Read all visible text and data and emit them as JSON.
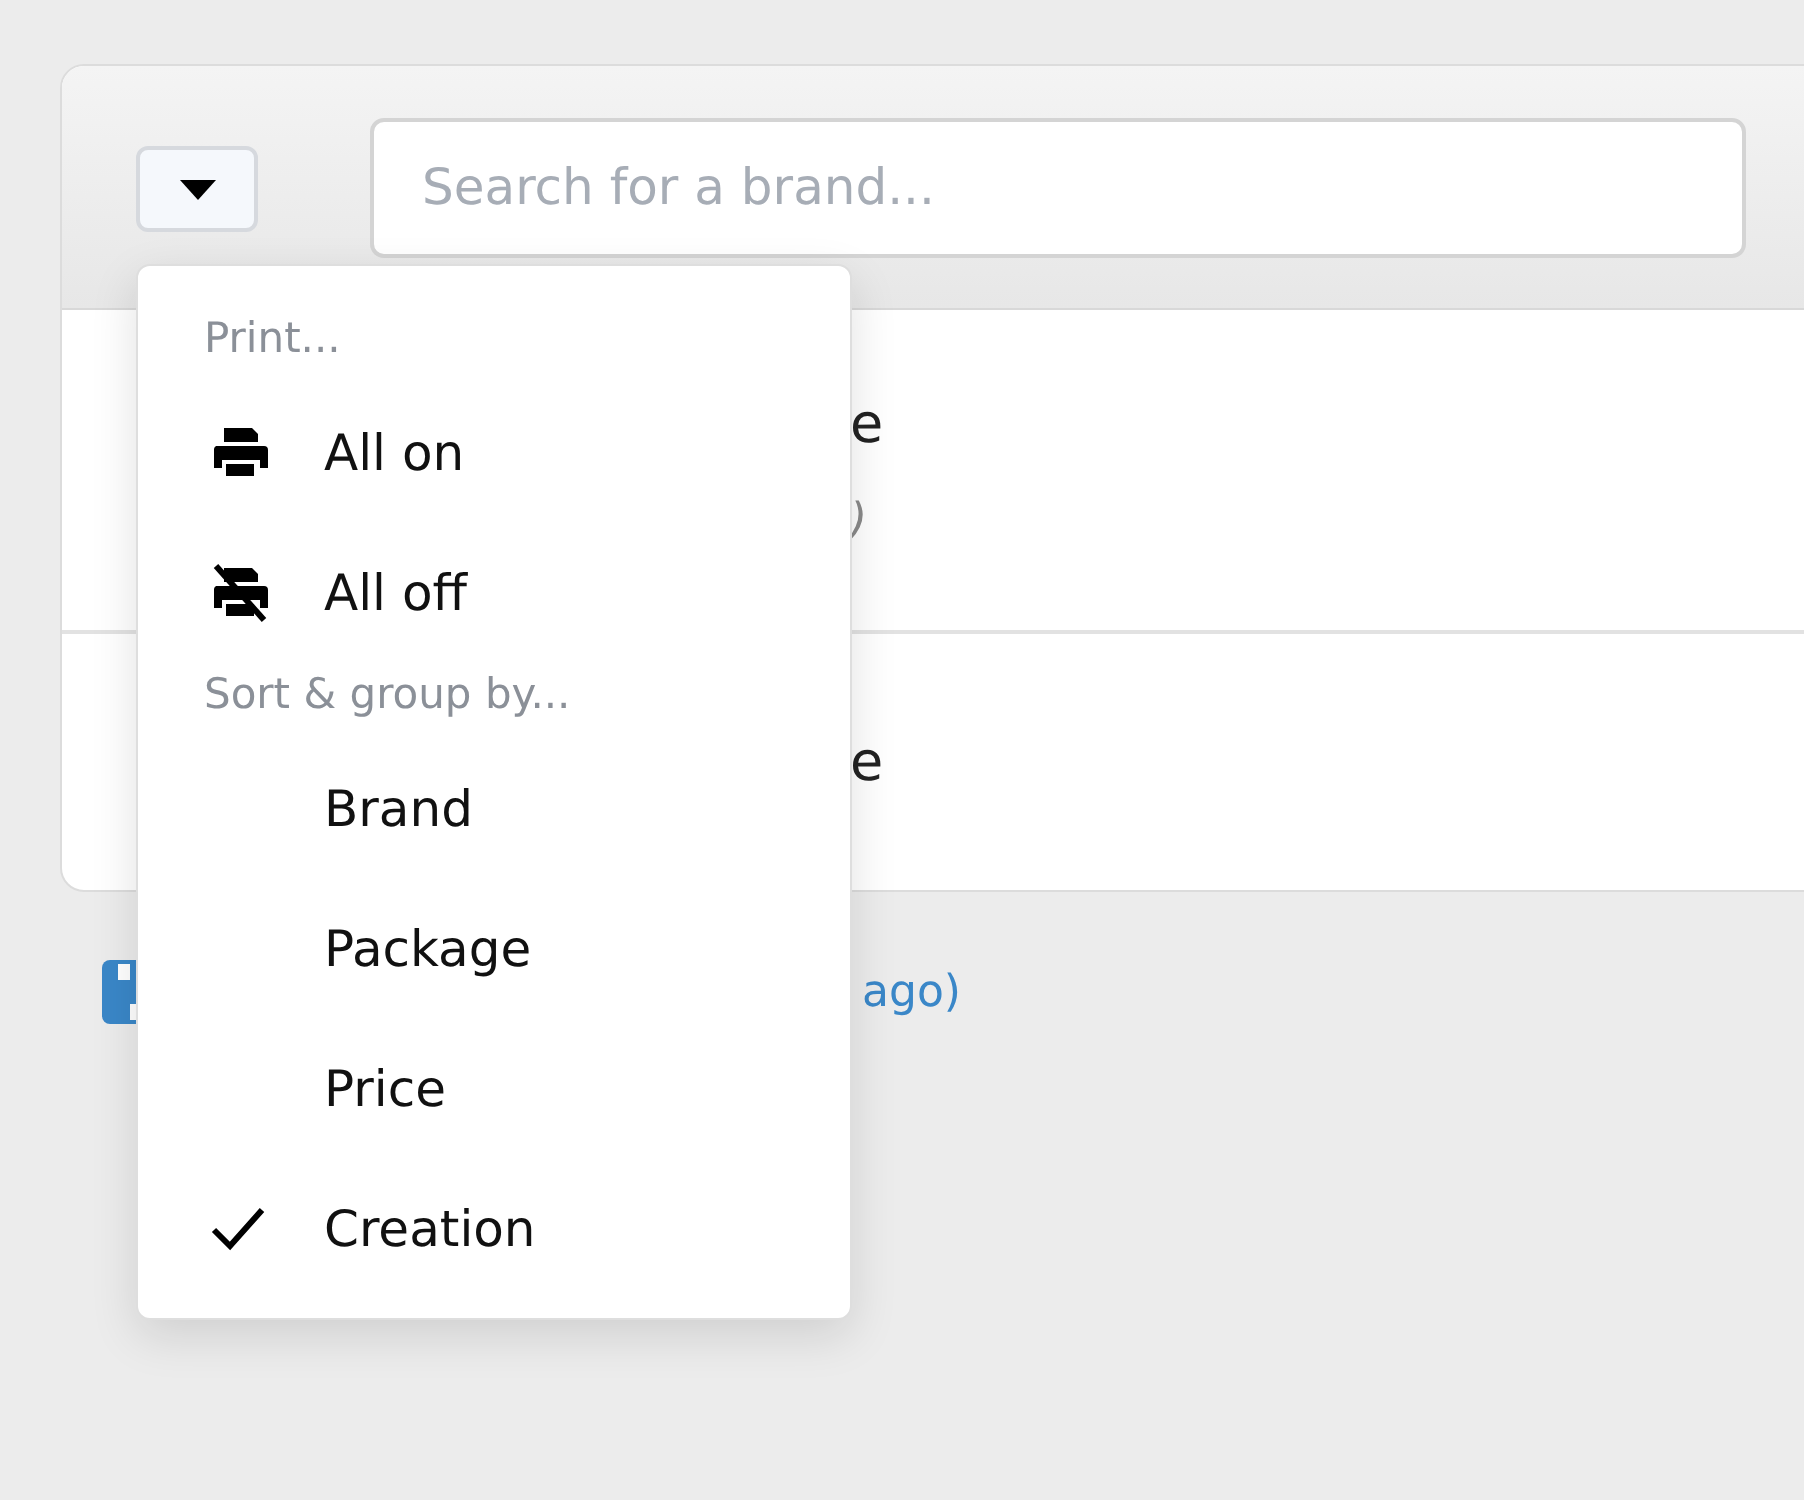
{
  "toolbar": {
    "menu_button": {
      "expanded": true
    },
    "search": {
      "placeholder": "Search for a brand..."
    }
  },
  "rows": [
    {
      "title": "e",
      "subtitle": ")"
    },
    {
      "title": "e"
    }
  ],
  "footer": {
    "link": "ago)"
  },
  "menu": {
    "sections": [
      {
        "heading": "Print...",
        "items": [
          {
            "kind": "print_on",
            "label": "All on"
          },
          {
            "kind": "print_off",
            "label": "All off"
          }
        ]
      },
      {
        "heading": "Sort & group by...",
        "items": [
          {
            "kind": "sort",
            "label": "Brand",
            "selected": false
          },
          {
            "kind": "sort",
            "label": "Package",
            "selected": false
          },
          {
            "kind": "sort",
            "label": "Price",
            "selected": false
          },
          {
            "kind": "sort",
            "label": "Creation",
            "selected": true
          }
        ]
      }
    ]
  }
}
